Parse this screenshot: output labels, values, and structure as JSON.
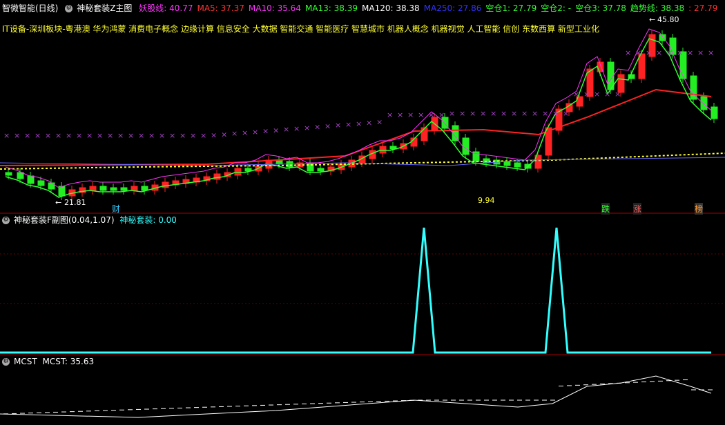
{
  "main_panel": {
    "title": "智微智能(日线)",
    "indicator_name": "神秘套装Z主图",
    "values": [
      {
        "label": "妖股线: 40.77",
        "color": "#ff33ff"
      },
      {
        "label": "MA5: 37.37",
        "color": "#ff3333"
      },
      {
        "label": "MA10: 35.64",
        "color": "#ff33ff"
      },
      {
        "label": "MA13: 38.39",
        "color": "#33ff33"
      },
      {
        "label": "MA120: 38.38",
        "color": "#ffffff"
      },
      {
        "label": "MA250: 27.86",
        "color": "#3333ff"
      },
      {
        "label": "空仓1: 27.79",
        "color": "#33ff33"
      },
      {
        "label": "空仓2: -",
        "color": "#33ff33"
      },
      {
        "label": "空仓3: 37.78",
        "color": "#33ff33"
      },
      {
        "label": "趋势线: 38.38",
        "color": "#33ff33"
      },
      {
        "label": ": 27.79",
        "color": "#ff3333"
      }
    ],
    "concepts": "IT设备-深圳板块-粤港澳 华为鸿蒙 消费电子概念 边缘计算 信息安全 大数据 智能交通 智能医疗 智慧城市 机器人概念 机器视觉 人工智能 信创 东数西算 新型工业化",
    "annotations": {
      "high": "45.80",
      "low": "21.81",
      "mid": "9.94",
      "cai": "财",
      "die": "跌",
      "zhang": "涨",
      "bang": "榜"
    }
  },
  "sub_panel_1": {
    "title": "神秘套装F副图(0.04,1.07)",
    "value": "神秘套装: 0.00",
    "value_color": "#33ffff"
  },
  "sub_panel_2": {
    "title": "MCST",
    "value": "MCST: 35.63"
  }
}
